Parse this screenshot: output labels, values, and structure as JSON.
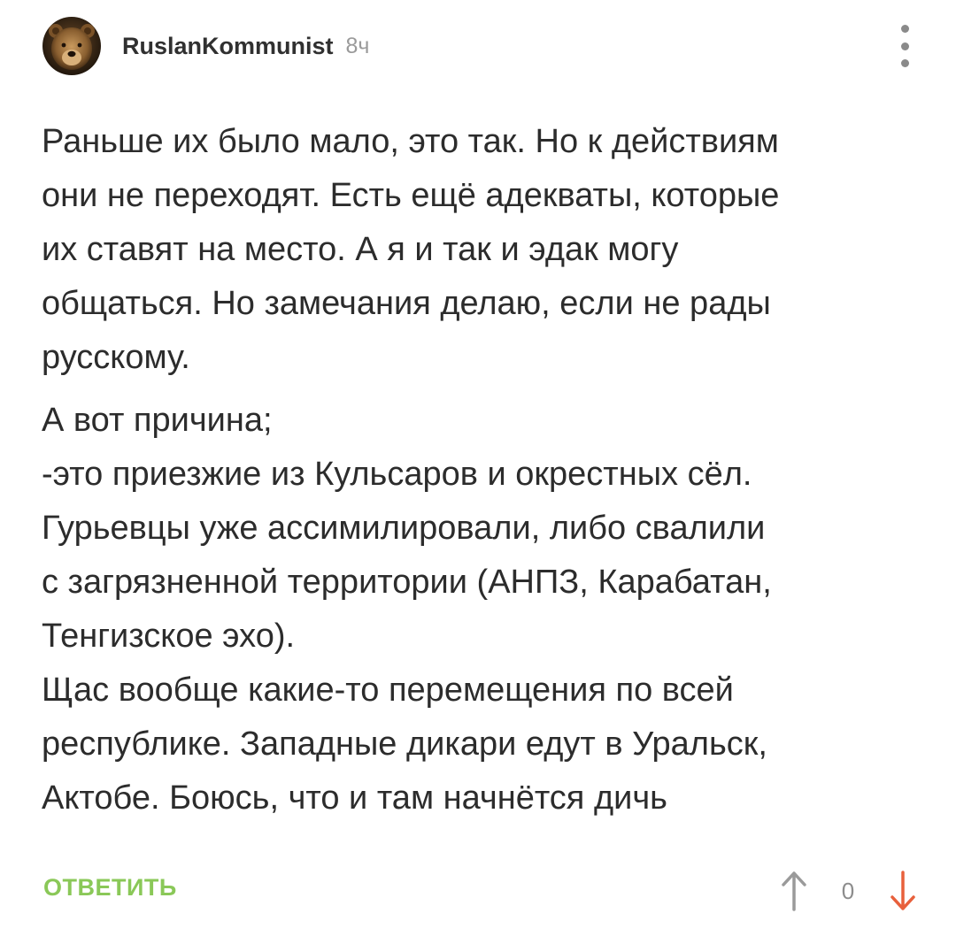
{
  "comment": {
    "author": "RuslanKommunist",
    "time": "8ч",
    "avatar_icon": "bear-avatar-icon",
    "more_icon": "more-vertical-icon",
    "paragraphs": [
      "Раньше их было мало, это так. Но к действиям",
      "они не переходят. Есть ещё адекваты, которые",
      "их ставят на место. А я и так и эдак могу",
      "общаться. Но замечания делаю, если не рады",
      "русскому.",
      "А вот причина;",
      "-это приезжие из Кульсаров и окрестных сёл.",
      "Гурьевцы уже ассимилировали, либо свалили",
      "с загрязненной территории (АНПЗ, Карабатан,",
      "Тенгизское эхо).",
      "Щас вообще какие-то перемещения по всей",
      "республике. Западные дикари едут в Уральск,",
      "Актобе. Боюсь, что и там начнётся дичь"
    ],
    "reply_label": "ОТВЕТИТЬ",
    "rating": "0",
    "upvote_icon": "arrow-up-icon",
    "downvote_icon": "arrow-down-icon",
    "colors": {
      "reply": "#8ac858",
      "upvote": "#9a9a9a",
      "downvote": "#e8603c",
      "text": "#2c2c2c",
      "meta": "#9a9a9a"
    }
  }
}
